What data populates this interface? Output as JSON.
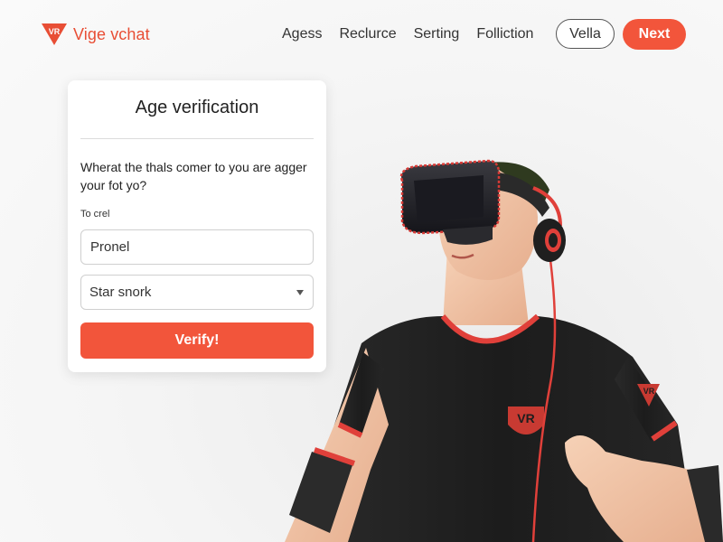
{
  "header": {
    "logo_mark_text": "VR",
    "brand": "Vige vchat",
    "nav": [
      "Agess",
      "Reclurce",
      "Serting",
      "Folliction"
    ],
    "outline_button": "Vella",
    "next_button": "Next"
  },
  "card": {
    "title": "Age verification",
    "question": "Wherat the thals comer to you are agger your fot yo?",
    "field_label": "To crel",
    "input_value": "Pronel",
    "select_value": "Star snork",
    "verify_button": "Verify!"
  },
  "illustration": {
    "shirt_logo": "VR",
    "sleeve_logo": "VR"
  },
  "colors": {
    "accent": "#f2553b",
    "shirt": "#1e1e1e",
    "trim": "#e0403a",
    "skin": "#f2c4a6"
  }
}
